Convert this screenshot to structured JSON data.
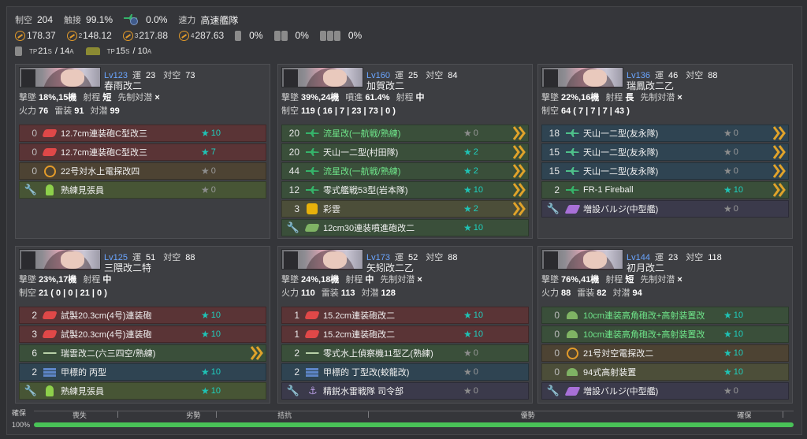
{
  "header": {
    "air_label": "制空",
    "air_value": "204",
    "dodge_label": "촉接",
    "dodge_value": "99.1%",
    "plane_pct": "0.0%",
    "speed_label": "速力",
    "speed_value": "高速艦隊",
    "los": [
      {
        "sub": "",
        "value": "178.37"
      },
      {
        "sub": "2",
        "value": "148.12"
      },
      {
        "sub": "3",
        "value": "217.88"
      },
      {
        "sub": "4",
        "value": "287.63"
      }
    ],
    "dc_pcts": [
      "0%",
      "0%",
      "0%"
    ],
    "tp_a": "TP21S / 14A",
    "tp_b": "TP15S / 10A"
  },
  "ships": [
    {
      "lv": "Lv123",
      "luck_label": "運",
      "luck": "23",
      "aa_label": "対空",
      "aa": "73",
      "name": "春雨改二",
      "stat1": [
        {
          "k": "撃墜",
          "v": "18%,15機"
        },
        {
          "k": "射程",
          "v": "短"
        },
        {
          "k": "先制対潜",
          "v": "×"
        }
      ],
      "stat2": [
        {
          "k": "火力",
          "v": "76"
        },
        {
          "k": "雷装",
          "v": "91"
        },
        {
          "k": "対潜",
          "v": "99"
        }
      ],
      "slots": [
        {
          "cnt": "0",
          "name": "12.7cm連装砲C型改三",
          "stars": "★10"
        },
        {
          "cnt": "0",
          "name": "12.7cm連装砲C型改三",
          "stars": "★7"
        },
        {
          "cnt": "0",
          "name": "22号対水上電探改四",
          "stars": "★0"
        },
        {
          "cnt": "",
          "name": "熟練見張員",
          "stars": "★0"
        }
      ]
    },
    {
      "lv": "Lv160",
      "luck_label": "運",
      "luck": "25",
      "aa_label": "対空",
      "aa": "84",
      "name": "加賀改二",
      "stat1": [
        {
          "k": "撃墜",
          "v": "39%,24機"
        },
        {
          "k": "噴進",
          "v": "61.4%"
        },
        {
          "k": "射程",
          "v": "中"
        }
      ],
      "stat2": [
        {
          "k": "制空",
          "v": "119 ( 16 | 7 | 23 | 73 | 0 )"
        }
      ],
      "slots": [
        {
          "cnt": "20",
          "name": "流星改(一航戦/熟練)",
          "stars": "★0"
        },
        {
          "cnt": "20",
          "name": "天山一二型(村田隊)",
          "stars": "★2"
        },
        {
          "cnt": "44",
          "name": "流星改(一航戦/熟練)",
          "stars": "★2"
        },
        {
          "cnt": "12",
          "name": "零式艦戦53型(岩本隊)",
          "stars": "★10"
        },
        {
          "cnt": "3",
          "name": "彩雲",
          "stars": "★2"
        },
        {
          "cnt": "",
          "name": "12cm30連装噴進砲改二",
          "stars": "★10"
        }
      ]
    },
    {
      "lv": "Lv136",
      "luck_label": "運",
      "luck": "46",
      "aa_label": "対空",
      "aa": "88",
      "name": "瑞鳳改二乙",
      "stat1": [
        {
          "k": "撃墜",
          "v": "22%,16機"
        },
        {
          "k": "射程",
          "v": "長"
        },
        {
          "k": "先制対潜",
          "v": "×"
        }
      ],
      "stat2": [
        {
          "k": "制空",
          "v": "64 ( 7 | 7 | 7 | 43 )"
        }
      ],
      "slots": [
        {
          "cnt": "18",
          "name": "天山一二型(友永隊)",
          "stars": "★0"
        },
        {
          "cnt": "15",
          "name": "天山一二型(友永隊)",
          "stars": "★0"
        },
        {
          "cnt": "15",
          "name": "天山一二型(友永隊)",
          "stars": "★0"
        },
        {
          "cnt": "2",
          "name": "FR-1 Fireball",
          "stars": "★10"
        },
        {
          "cnt": "",
          "name": "増設バルジ(中型艦)",
          "stars": "★0"
        }
      ]
    },
    {
      "lv": "Lv125",
      "luck_label": "運",
      "luck": "51",
      "aa_label": "対空",
      "aa": "88",
      "name": "三隈改二特",
      "stat1": [
        {
          "k": "撃墜",
          "v": "23%,17機"
        },
        {
          "k": "射程",
          "v": "中"
        }
      ],
      "stat2": [
        {
          "k": "制空",
          "v": "21 ( 0 | 0 | 21 | 0 )"
        }
      ],
      "slots": [
        {
          "cnt": "2",
          "name": "試製20.3cm(4号)連装砲",
          "stars": "★10"
        },
        {
          "cnt": "3",
          "name": "試製20.3cm(4号)連装砲",
          "stars": "★10"
        },
        {
          "cnt": "6",
          "name": "瑞雲改二(六三四空/熟練)",
          "stars": ""
        },
        {
          "cnt": "2",
          "name": "甲標的 丙型",
          "stars": "★10"
        },
        {
          "cnt": "",
          "name": "熟練見張員",
          "stars": "★10"
        }
      ]
    },
    {
      "lv": "Lv173",
      "luck_label": "運",
      "luck": "52",
      "aa_label": "対空",
      "aa": "88",
      "name": "矢矧改二乙",
      "stat1": [
        {
          "k": "撃墜",
          "v": "24%,18機"
        },
        {
          "k": "射程",
          "v": "中"
        },
        {
          "k": "先制対潜",
          "v": "×"
        }
      ],
      "stat2": [
        {
          "k": "火力",
          "v": "110"
        },
        {
          "k": "雷装",
          "v": "113"
        },
        {
          "k": "対潜",
          "v": "128"
        }
      ],
      "slots": [
        {
          "cnt": "1",
          "name": "15.2cm連装砲改二",
          "stars": "★10"
        },
        {
          "cnt": "1",
          "name": "15.2cm連装砲改二",
          "stars": "★10"
        },
        {
          "cnt": "2",
          "name": "零式水上偵察機11型乙(熟練)",
          "stars": "★0"
        },
        {
          "cnt": "2",
          "name": "甲標的 丁型改(蛟龍改)",
          "stars": "★0"
        },
        {
          "cnt": "",
          "name": "精鋭水雷戦隊 司令部",
          "stars": "★0"
        }
      ]
    },
    {
      "lv": "Lv144",
      "luck_label": "運",
      "luck": "23",
      "aa_label": "対空",
      "aa": "118",
      "name": "初月改二",
      "stat1": [
        {
          "k": "撃墜",
          "v": "76%,41機"
        },
        {
          "k": "射程",
          "v": "短"
        },
        {
          "k": "先制対潜",
          "v": "×"
        }
      ],
      "stat2": [
        {
          "k": "火力",
          "v": "88"
        },
        {
          "k": "雷装",
          "v": "82"
        },
        {
          "k": "対潜",
          "v": "94"
        }
      ],
      "slots": [
        {
          "cnt": "0",
          "name": "10cm連装高角砲改+高射装置改",
          "stars": "★10"
        },
        {
          "cnt": "0",
          "name": "10cm連装高角砲改+高射装置改",
          "stars": "★10"
        },
        {
          "cnt": "0",
          "name": "21号対空電探改二",
          "stars": "★10"
        },
        {
          "cnt": "0",
          "name": "94式高射装置",
          "stars": "★10"
        },
        {
          "cnt": "",
          "name": "増設バルジ(中型艦)",
          "stars": "★0"
        }
      ]
    }
  ],
  "footer": {
    "left_top": "確保",
    "left_bottom": "100%",
    "scale": [
      "喪失",
      "劣勢",
      "拮抗",
      "優勢",
      "確保"
    ],
    "fill": 1.0
  }
}
